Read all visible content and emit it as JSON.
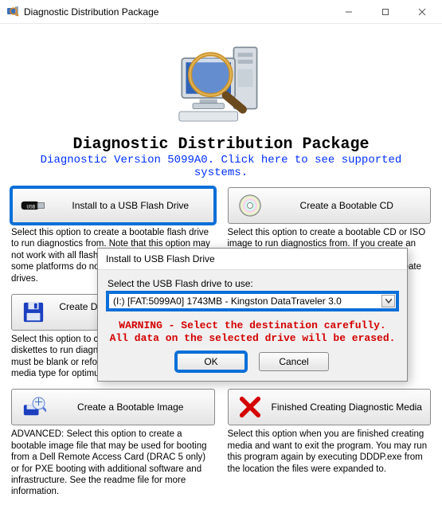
{
  "window": {
    "title": "Diagnostic Distribution Package"
  },
  "heading": "Diagnostic Distribution Package",
  "version_link": "Diagnostic Version 5099A0. Click here to see supported systems.",
  "cells": {
    "usb": {
      "label": "Install to a USB Flash Drive",
      "desc": "Select this option to create a bootable flash drive to run diagnostics from. Note that this option may not work with all flash drive products and that some platforms do not support booting from USB drives."
    },
    "cd": {
      "label": "Create a Bootable CD",
      "desc": "Select this option to create a bootable CD or ISO image to run diagnostics from. If you create an image file, you will need software capable of creating a CD from that image to actually create the CD."
    },
    "diskette": {
      "label": "Create Diskette Set or Hard Drive Partition",
      "desc": "Select this option to create a set of bootable diskettes to run diagnostics from. The diskettes must be blank or reformatted. It is the preferred media type for optimum run time performance."
    },
    "image": {
      "label": "Create a Bootable Image",
      "desc": "ADVANCED: Select this option to create a bootable image file that may be used for booting from a Dell Remote Access Card (DRAC 5 only) or for PXE booting with additional software and infrastructure. See the readme file for more information."
    },
    "finish": {
      "label": "Finished Creating Diagnostic Media",
      "desc": "Select this option when you are finished creating media and want to exit the program. You may run this program again by executing DDDP.exe from the location the files were expanded to."
    }
  },
  "modal": {
    "title": "Install to USB Flash Drive",
    "prompt": "Select the USB Flash drive to use:",
    "selected": "(I:) [FAT:5099A0] 1743MB - Kingston DataTraveler 3.0",
    "warning": "WARNING - Select the destination carefully. All data on the selected drive will be erased.",
    "ok": "OK",
    "cancel": "Cancel"
  }
}
